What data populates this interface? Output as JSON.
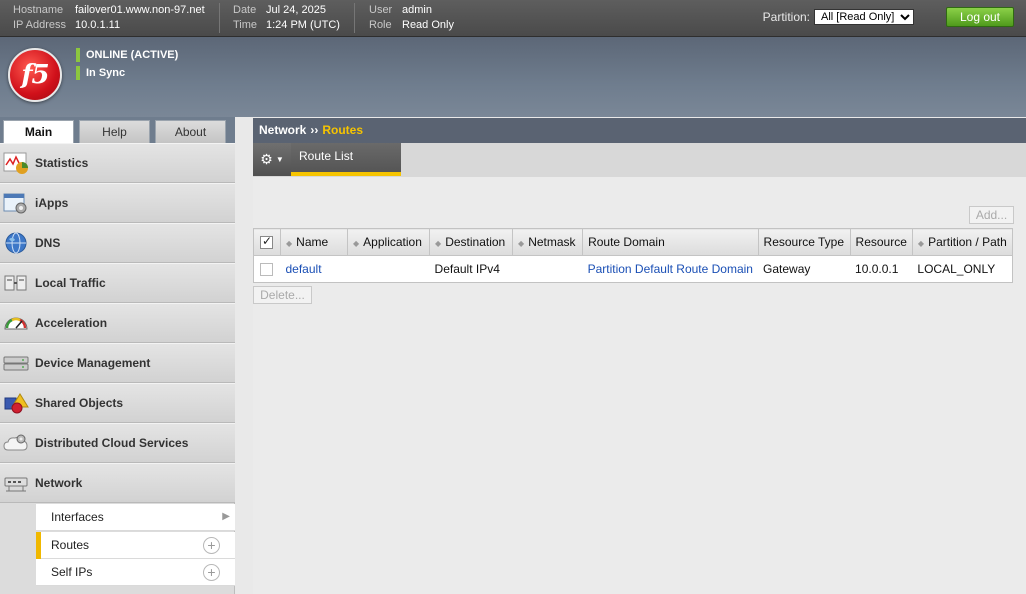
{
  "header": {
    "hostname_label": "Hostname",
    "hostname": "failover01.www.non-97.net",
    "ip_label": "IP Address",
    "ip": "10.0.1.11",
    "date_label": "Date",
    "date": "Jul 24, 2025",
    "time_label": "Time",
    "time": "1:24 PM (UTC)",
    "user_label": "User",
    "user": "admin",
    "role_label": "Role",
    "role": "Read Only",
    "partition_label": "Partition:",
    "partition_value": "All [Read Only]",
    "logout_label": "Log out"
  },
  "banner": {
    "logo_text": "f5",
    "status_online": "ONLINE (ACTIVE)",
    "status_sync": "In Sync",
    "status_color": "#8cc63f"
  },
  "left_tabs": [
    {
      "label": "Main",
      "active": true
    },
    {
      "label": "Help",
      "active": false
    },
    {
      "label": "About",
      "active": false
    }
  ],
  "sidebar": {
    "items": [
      {
        "label": "Statistics",
        "icon": "statistics-icon"
      },
      {
        "label": "iApps",
        "icon": "iapps-icon"
      },
      {
        "label": "DNS",
        "icon": "dns-globe-icon"
      },
      {
        "label": "Local Traffic",
        "icon": "local-traffic-icon"
      },
      {
        "label": "Acceleration",
        "icon": "acceleration-gauge-icon"
      },
      {
        "label": "Device Management",
        "icon": "device-management-icon"
      },
      {
        "label": "Shared Objects",
        "icon": "shared-objects-icon"
      },
      {
        "label": "Distributed Cloud Services",
        "icon": "cloud-gear-icon"
      },
      {
        "label": "Network",
        "icon": "network-icon"
      }
    ],
    "subitems": [
      {
        "label": "Interfaces",
        "has_submenu": true
      },
      {
        "label": "Routes",
        "active": true,
        "has_add": true
      },
      {
        "label": "Self IPs",
        "has_add": true
      }
    ]
  },
  "breadcrumb": {
    "parent": "Network",
    "separator": "››",
    "current": "Routes"
  },
  "tabs": {
    "gear_icon": "gear-icon",
    "route_list": "Route List"
  },
  "buttons": {
    "add": "Add...",
    "delete": "Delete..."
  },
  "table": {
    "columns": [
      "Name",
      "Application",
      "Destination",
      "Netmask",
      "Route Domain",
      "Resource Type",
      "Resource",
      "Partition / Path"
    ],
    "rows": [
      {
        "name": "default",
        "application": "",
        "destination": "Default IPv4",
        "netmask": "",
        "route_domain": "Partition Default Route Domain",
        "resource_type": "Gateway",
        "resource": "10.0.0.1",
        "partition_path": "LOCAL_ONLY"
      }
    ]
  },
  "colors": {
    "accent_yellow": "#f6c400",
    "logout_green": "#5aa52a",
    "link_blue": "#1a4fb5"
  }
}
